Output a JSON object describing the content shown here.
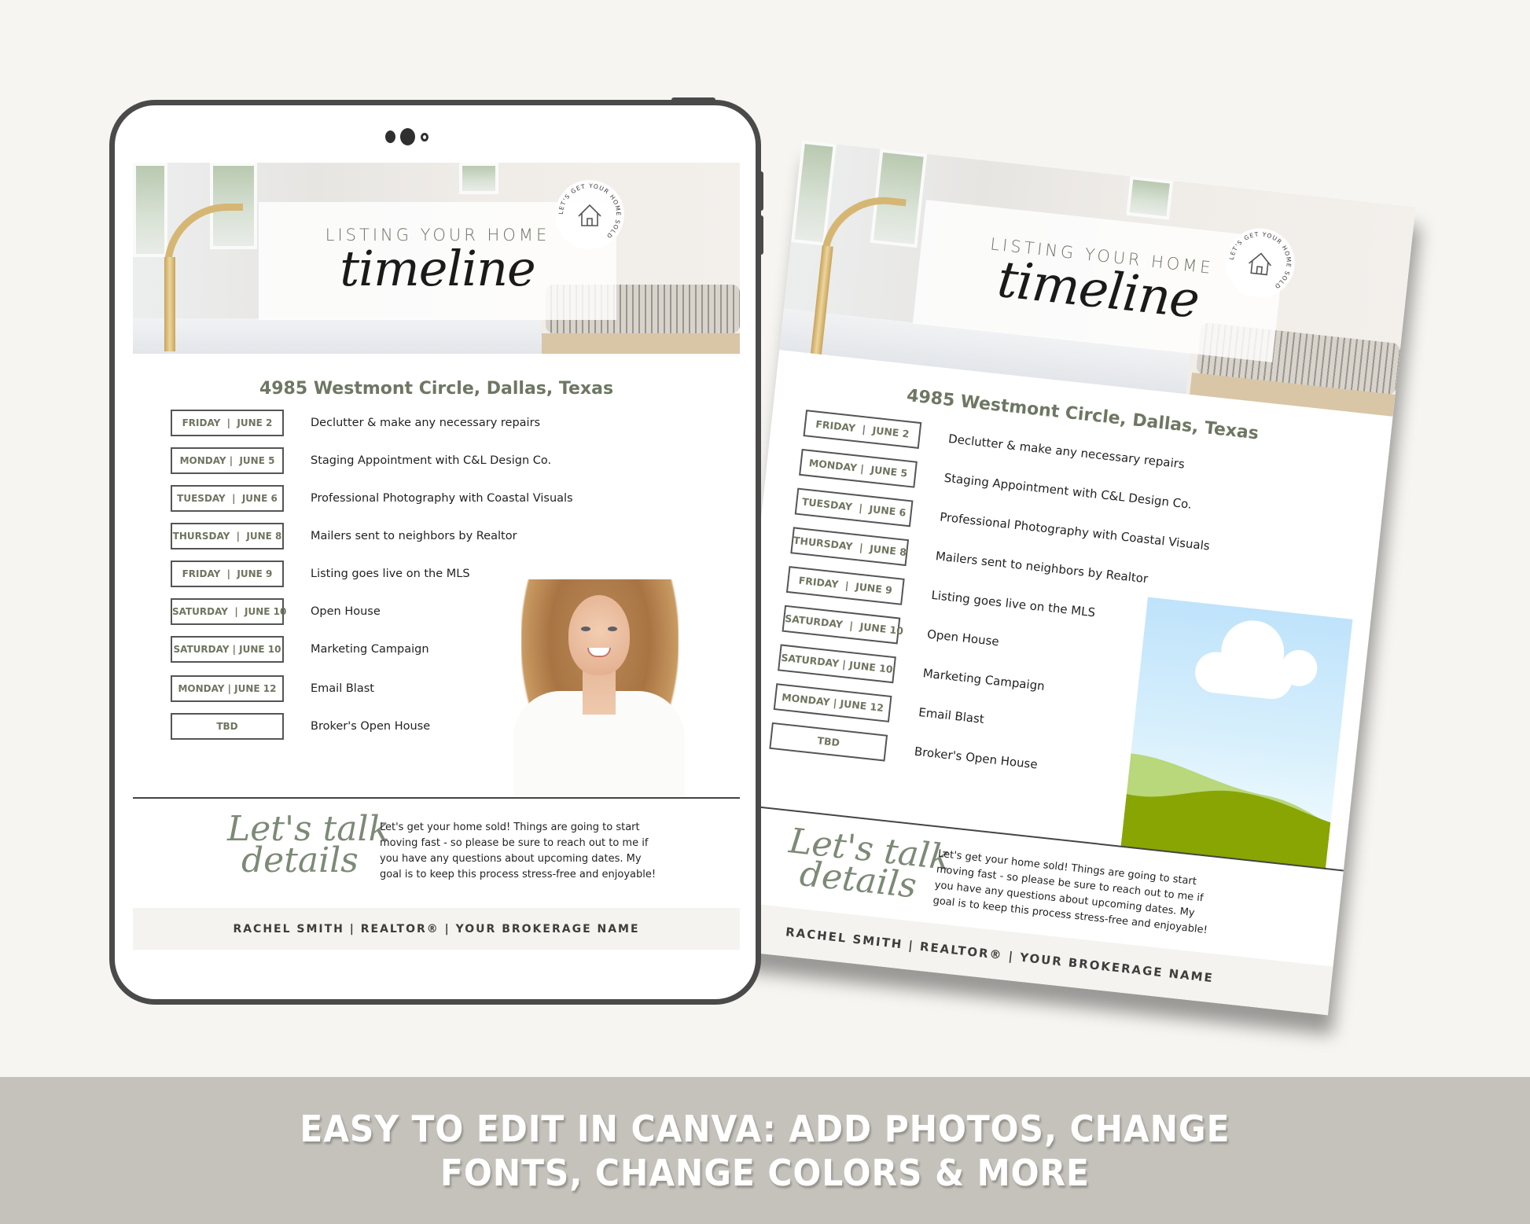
{
  "banner": {
    "line1": "EASY TO EDIT IN CANVA: ADD PHOTOS, CHANGE",
    "line2": "FONTS, CHANGE COLORS & MORE"
  },
  "flyer": {
    "kicker": "LISTING YOUR HOME",
    "title_script": "timeline",
    "badge_text": "LET'S GET YOUR HOME SOLD",
    "address": "4985 Westmont Circle, Dallas, Texas",
    "timeline": [
      {
        "date": "FRIDAY  |  JUNE 2",
        "task": "Declutter & make any necessary repairs"
      },
      {
        "date": "MONDAY |  JUNE 5",
        "task": "Staging Appointment with C&L Design Co."
      },
      {
        "date": "TUESDAY  |  JUNE 6",
        "task": "Professional Photography with Coastal Visuals"
      },
      {
        "date": "THURSDAY  |  JUNE 8",
        "task": "Mailers sent to neighbors by Realtor"
      },
      {
        "date": "FRIDAY  |  JUNE 9",
        "task": "Listing goes live on the MLS"
      },
      {
        "date": "SATURDAY  |  JUNE 10",
        "task": "Open House"
      },
      {
        "date": "SATURDAY | JUNE 10",
        "task": "Marketing Campaign"
      },
      {
        "date": "MONDAY | JUNE 12",
        "task": "Email Blast"
      },
      {
        "date": "TBD",
        "task": "Broker's Open House"
      }
    ],
    "script_line1": "Let's talk",
    "script_line2": "details",
    "blurb_lines": [
      "Let's get your home sold! Things are going to start",
      "moving fast - so please be sure to reach out to me if",
      "you have any questions about upcoming dates. My",
      "goal is to keep this process stress-free and enjoyable!"
    ],
    "footer": "RACHEL SMITH |  REALTOR®  |  YOUR BROKERAGE NAME"
  },
  "colors": {
    "accent_green": "#6d7763",
    "frame": "#4a4a4a",
    "background": "#f6f5f1",
    "banner": "#c5c2bb"
  }
}
